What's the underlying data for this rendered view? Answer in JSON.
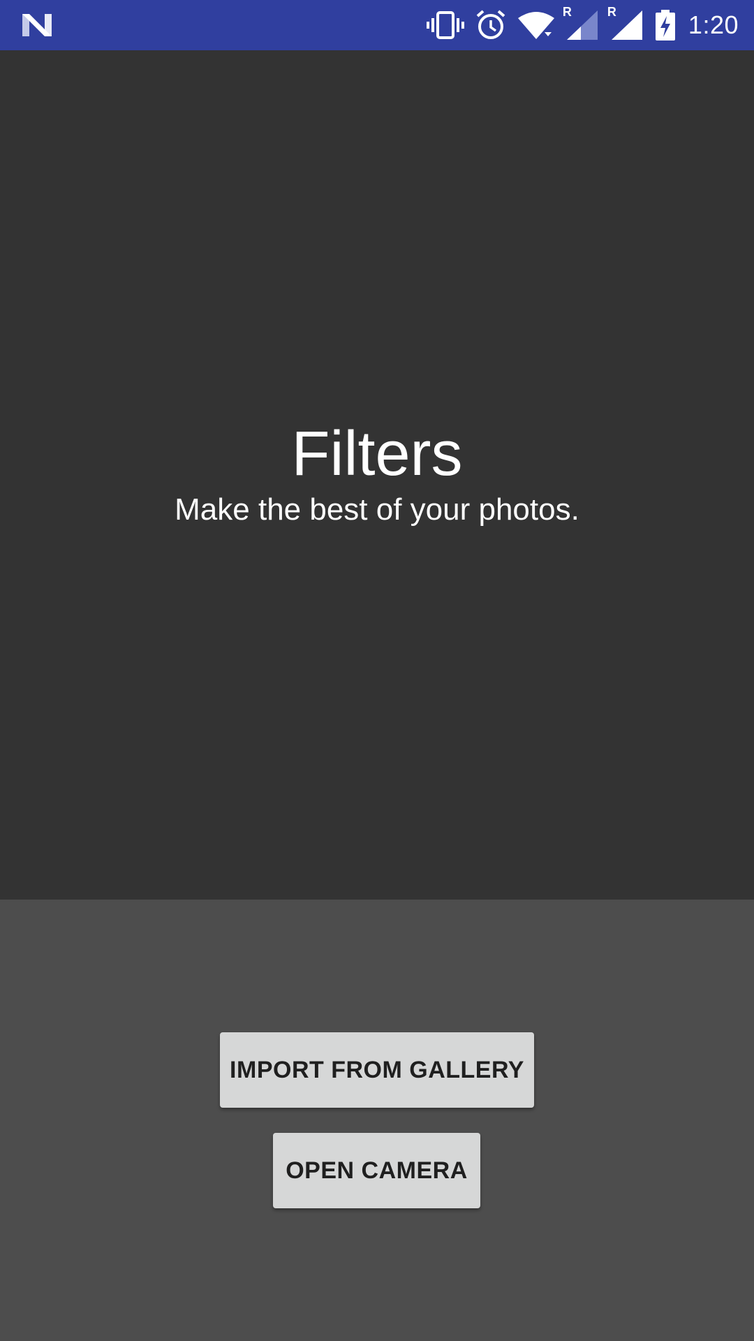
{
  "status_bar": {
    "notification_icon": "android-n-icon",
    "icons": [
      "vibrate-icon",
      "alarm-icon",
      "wifi-icon",
      "signal-roaming-icon",
      "signal-roaming-icon",
      "battery-charging-icon"
    ],
    "roaming_label_1": "R",
    "roaming_label_2": "R",
    "time": "1:20",
    "background_color": "#303f9f"
  },
  "hero": {
    "title": "Filters",
    "subtitle": "Make the best of your photos.",
    "background_color": "#333333"
  },
  "actions": {
    "import_button_label": "IMPORT FROM GALLERY",
    "camera_button_label": "OPEN CAMERA",
    "background_color": "#4d4d4d",
    "button_color": "#d6d7d7"
  }
}
